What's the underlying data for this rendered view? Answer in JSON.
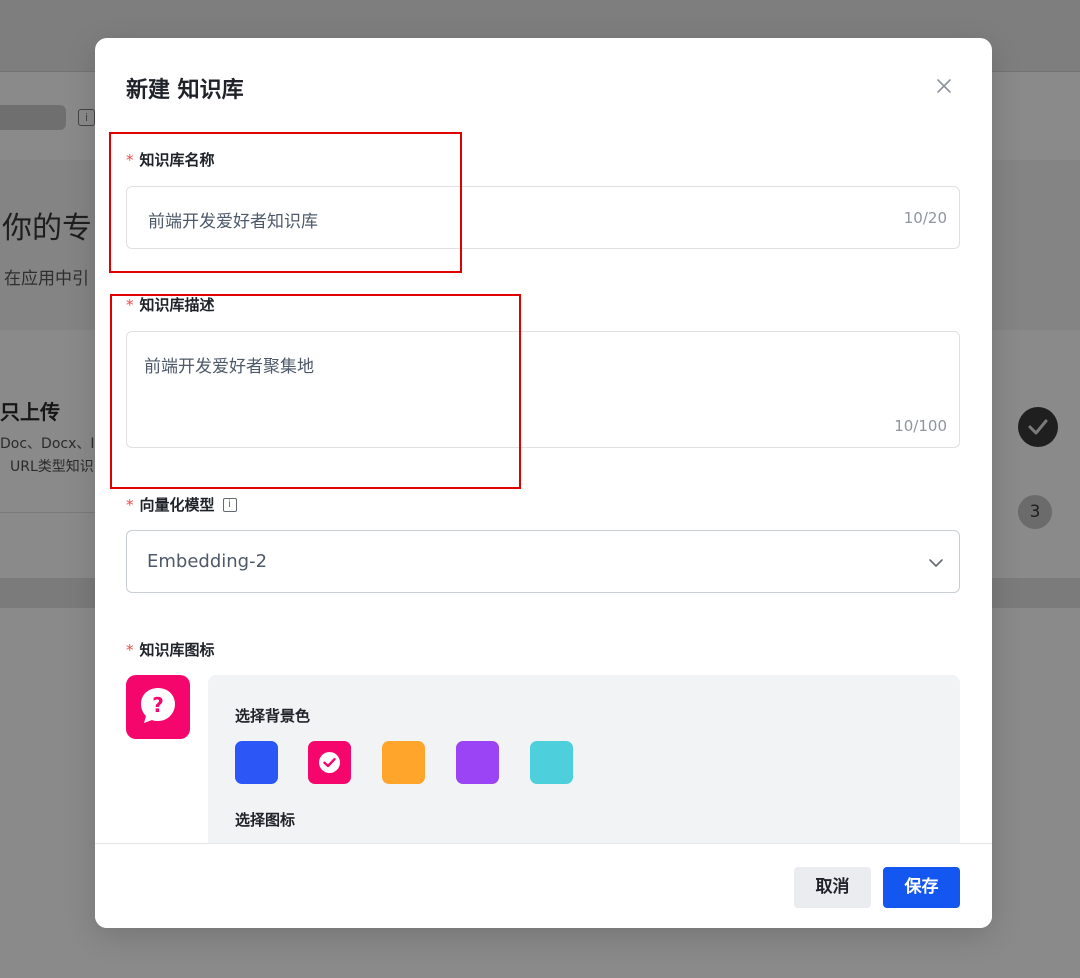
{
  "background": {
    "hero_title": "你的专",
    "hero_subtitle": "在应用中引",
    "card_title": "只上传",
    "card_line1": "Doc、Docx、I",
    "card_line2": "URL类型知识",
    "step_number": "3",
    "info_glyph": "i"
  },
  "modal": {
    "title": "新建 知识库",
    "close_icon": "close-icon",
    "fields": {
      "name": {
        "required_mark": "*",
        "label": "知识库名称",
        "value": "前端开发爱好者知识库",
        "counter": "10/20"
      },
      "description": {
        "required_mark": "*",
        "label": "知识库描述",
        "value": "前端开发爱好者聚集地",
        "counter": "10/100"
      },
      "model": {
        "required_mark": "*",
        "label": "向量化模型",
        "info_glyph": "i",
        "selected": "Embedding-2"
      },
      "icon": {
        "required_mark": "*",
        "label": "知识库图标",
        "current_icon": "question-bubble-icon",
        "current_color": "#f5066d",
        "bg_color_title": "选择背景色",
        "colors": [
          "#2c56f5",
          "#f5066d",
          "#ffa52c",
          "#9a44f5",
          "#4dcfdc"
        ],
        "selected_color_index": 1,
        "icon_title": "选择图标"
      }
    },
    "footer": {
      "cancel_label": "取消",
      "save_label": "保存"
    }
  },
  "colors": {
    "primary": "#1456f0",
    "required": "#f54a45",
    "annotation": "#e00000"
  }
}
